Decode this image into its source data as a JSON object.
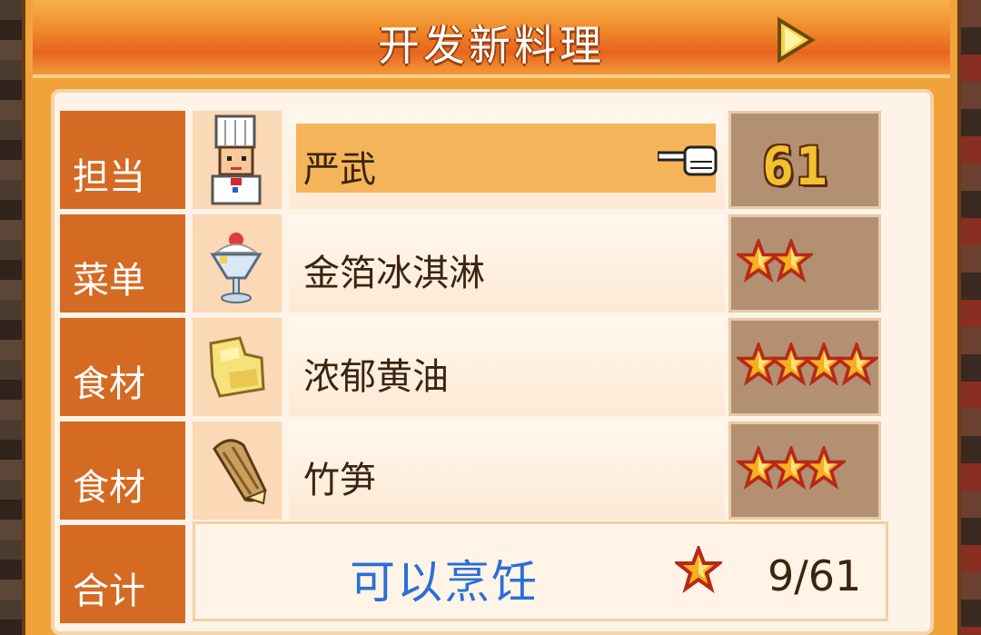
{
  "title": "开发新料理",
  "rows": [
    {
      "label": "担当",
      "name": "严武",
      "icon": "chef-icon",
      "level": "61",
      "selected": true
    },
    {
      "label": "菜单",
      "name": "金箔冰淇淋",
      "icon": "sundae-icon",
      "stars": 2
    },
    {
      "label": "食材",
      "name": "浓郁黄油",
      "icon": "butter-icon",
      "stars": 4
    },
    {
      "label": "食材",
      "name": "竹笋",
      "icon": "bamboo-shoot-icon",
      "stars": 3
    }
  ],
  "total": {
    "label": "合计",
    "status": "可以烹饪",
    "count": "9/61"
  },
  "colors": {
    "accent": "#f08a2a",
    "label_bg": "#d56a22",
    "status": "#2b6fd6",
    "star": "#f6b020"
  }
}
